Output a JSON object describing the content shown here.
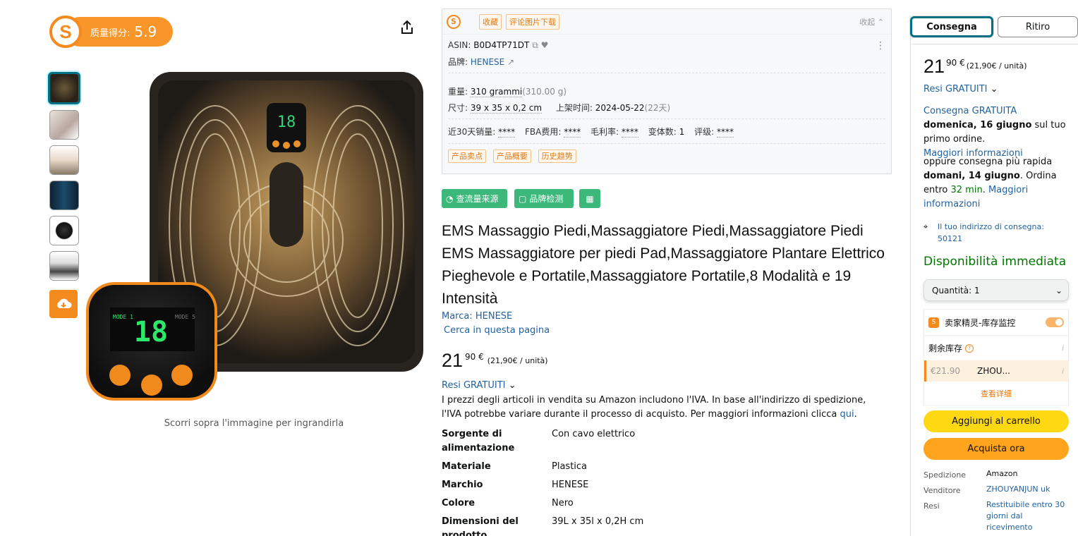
{
  "quality": {
    "label": "质量得分:",
    "score": "5.9"
  },
  "image": {
    "caption": "Scorri sopra l'immagine per ingrandirla"
  },
  "info": {
    "tags": [
      "收藏",
      "评论图片下载"
    ],
    "collapse": "收起",
    "asin_label": "ASIN:",
    "asin": "B0D4TP71DT",
    "brand_label": "品牌:",
    "brand": "HENESE",
    "weight_label": "重量:",
    "weight": "310 grammi",
    "weight_g": "(310.00 g)",
    "size_label": "尺寸:",
    "size": "39 x 35 x 0,2 cm",
    "date_label": "上架时间:",
    "date": "2024-05-22",
    "date_days": "(22天)",
    "sales_label": "近30天销量:",
    "sales": "****",
    "fba_label": "FBA费用:",
    "fba": "****",
    "margin_label": "毛利率:",
    "margin": "****",
    "variants_label": "变体数:",
    "variants": "1",
    "rating_label": "评级:",
    "rating": "****",
    "bottom_tags": [
      "产品卖点",
      "产品概要",
      "历史趋势"
    ]
  },
  "tools": {
    "traffic": "查流量来源",
    "brand_check": "品牌检测"
  },
  "product": {
    "title": "EMS Massaggio Piedi,Massaggiatore Piedi,Massaggiatore Piedi EMS Massaggiatore per piedi Pad,Massaggiatore Plantare Elettrico Pieghevole e Portatile,Massaggiatore Portatile,8 Modalità e 19 Intensità",
    "brand": "Marca: HENESE",
    "search": "Cerca in questa pagina",
    "price_whole": "21",
    "price_frac": "90 €",
    "price_unit": "(21,90€ / unità)",
    "resi": "Resi GRATUITI",
    "vat": "I prezzi degli articoli in vendita su Amazon includono l'IVA. In base all'indirizzo di spedizione, l'IVA potrebbe variare durante il processo di acquisto. Per maggiori informazioni clicca",
    "vat_link": "qui",
    "specs": [
      {
        "k": "Sorgente di alimentazione",
        "v": "Con cavo elettrico"
      },
      {
        "k": "Materiale",
        "v": "Plastica"
      },
      {
        "k": "Marchio",
        "v": "HENESE"
      },
      {
        "k": "Colore",
        "v": "Nero"
      },
      {
        "k": "Dimensioni del prodotto",
        "v": "39L x 35l x 0,2H cm"
      }
    ]
  },
  "buybox": {
    "tab_delivery": "Consegna",
    "tab_pickup": "Ritiro",
    "price_whole": "21",
    "price_frac": "90 €",
    "price_unit": "(21,90€ / unità)",
    "resi": "Resi GRATUITI",
    "free_delivery": "Consegna GRATUITA",
    "free_date": "domenica, 16 giugno",
    "free_suffix": "sul tuo primo ordine.",
    "more_info": "Maggiori informazioni",
    "fast_prefix": "oppure consegna più rapida",
    "fast_date": "domani, 14 giugno",
    "fast_order": ". Ordina entro",
    "fast_time": "32 min",
    "fast_more": "Maggiori informazioni",
    "address": "Il tuo indirizzo di consegna: 50121",
    "availability": "Disponibilità immediata",
    "qty_label": "Quantità:",
    "qty": "1",
    "sj_title": "卖家精灵-库存监控",
    "stock_label": "剩余库存",
    "stock_price": "€21.90",
    "stock_seller": "ZHOU...",
    "stock_more": "查看详细",
    "add_cart": "Aggiungi al carrello",
    "buy_now": "Acquista ora",
    "ship_label": "Spedizione",
    "ship": "Amazon",
    "seller_label": "Venditore",
    "seller": "ZHOUYANJUN uk",
    "returns_label": "Resi",
    "returns": "Restituibile entro 30 giorni dal ricevimento"
  }
}
